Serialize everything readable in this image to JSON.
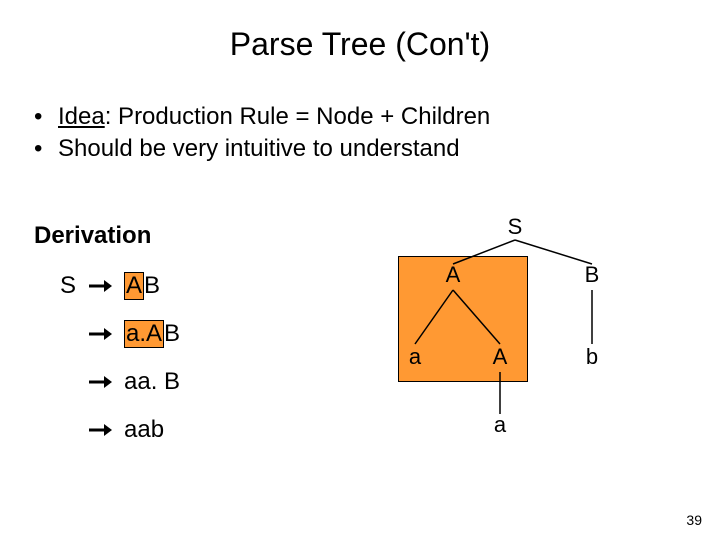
{
  "title": "Parse Tree (Con't)",
  "bullets": {
    "b1_idea": "Idea",
    "b1_rest": ": Production Rule = Node + Children",
    "b2": "Should be very intuitive to understand"
  },
  "derivation": {
    "heading": "Derivation",
    "step1": {
      "lhs": "S",
      "hl": "A",
      "rest": "B"
    },
    "step2": {
      "hl": "a.A",
      "rest": "B"
    },
    "step3": {
      "text": "aa. B"
    },
    "step4": {
      "text": "aab"
    }
  },
  "tree": {
    "S": "S",
    "A": "A",
    "B": "B",
    "a1": "a",
    "A2": "A",
    "b": "b",
    "a2": "a"
  },
  "page": "39"
}
